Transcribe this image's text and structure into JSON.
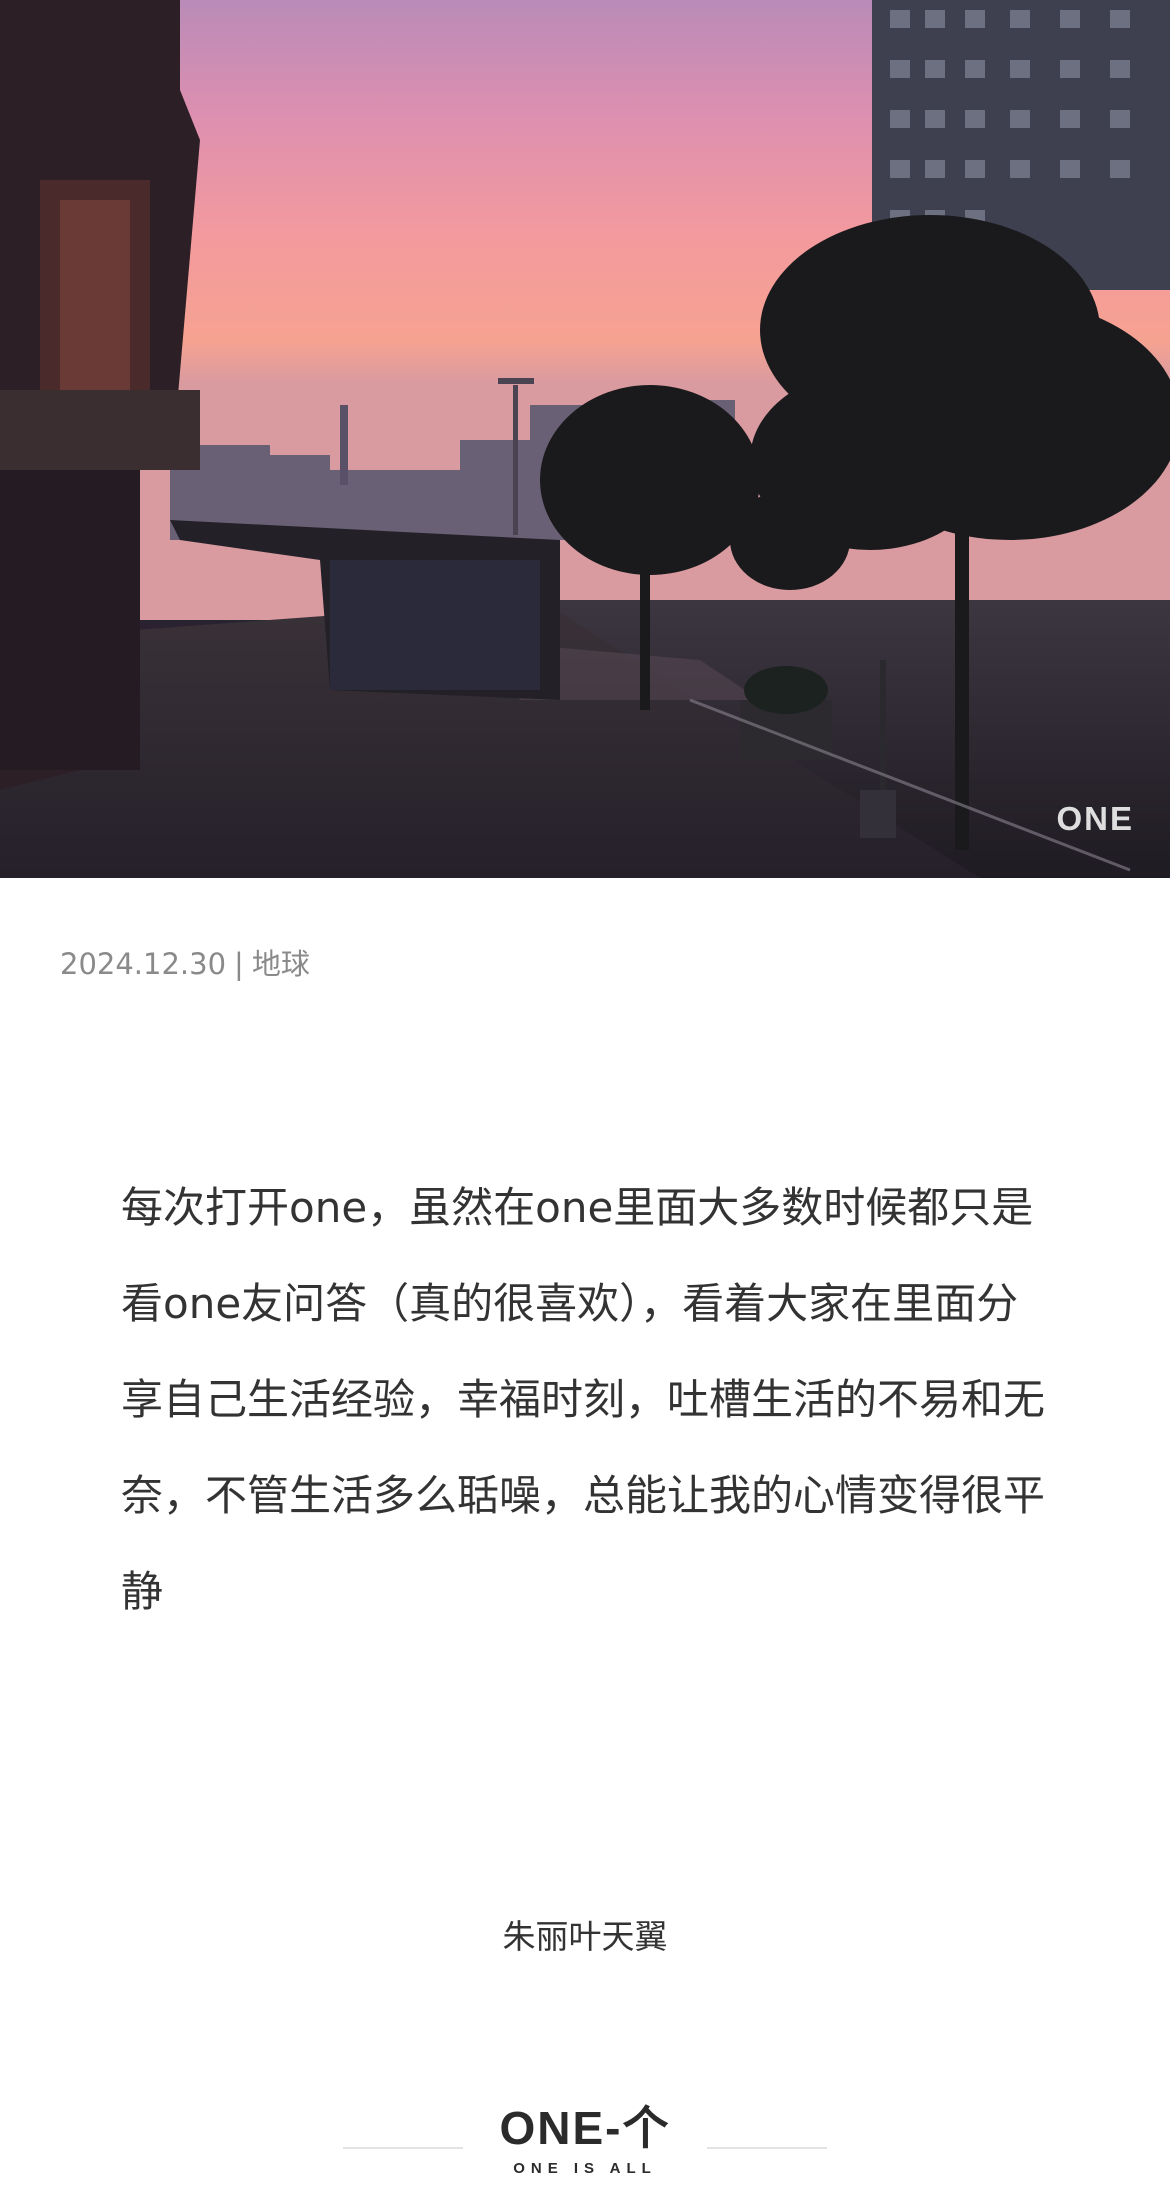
{
  "hero": {
    "watermark": "ONE"
  },
  "meta": {
    "date": "2024.12.30",
    "separator": "|",
    "location": "地球"
  },
  "article": {
    "text": "每次打开one，虽然在one里面大多数时候都只是看one友问答（真的很喜欢），看着大家在里面分享自己生活经验，幸福时刻，吐槽生活的不易和无奈，不管生活多么聒噪，总能让我的心情变得很平静"
  },
  "author": {
    "name": "朱丽叶天翼"
  },
  "footer": {
    "logo_main": "ONE-个",
    "logo_sub": "ONE IS ALL"
  },
  "colors": {
    "sky_top": "#c48ab0",
    "sky_mid": "#f39a9a",
    "sky_low": "#f7a08c",
    "text": "#333333",
    "meta": "#8a8a8a"
  }
}
